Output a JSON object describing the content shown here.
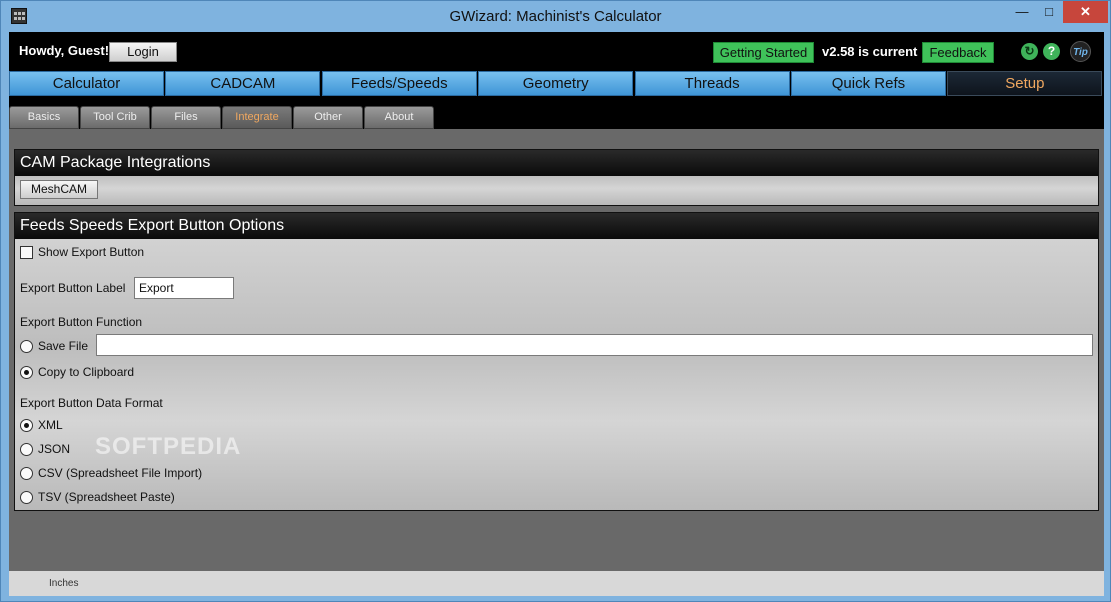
{
  "window": {
    "title": "GWizard: Machinist's Calculator"
  },
  "topbar": {
    "greeting": "Howdy, Guest!",
    "login_label": "Login",
    "getting_started_label": "Getting Started",
    "version_text": "v2.58 is current",
    "feedback_label": "Feedback",
    "icons": [
      "refresh-icon",
      "help-icon",
      "tip-icon"
    ],
    "help_glyph": "?",
    "tip_label": "Tip"
  },
  "main_nav": {
    "tabs": [
      {
        "label": "Calculator"
      },
      {
        "label": "CADCAM"
      },
      {
        "label": "Feeds/Speeds"
      },
      {
        "label": "Geometry"
      },
      {
        "label": "Threads"
      },
      {
        "label": "Quick Refs"
      },
      {
        "label": "Setup"
      }
    ],
    "active": "Setup"
  },
  "sub_nav": {
    "tabs": [
      {
        "label": "Basics"
      },
      {
        "label": "Tool Crib"
      },
      {
        "label": "Files"
      },
      {
        "label": "Integrate"
      },
      {
        "label": "Other"
      },
      {
        "label": "About"
      }
    ],
    "active": "Integrate"
  },
  "cam_panel": {
    "title": "CAM Package Integrations",
    "meshcam_label": "MeshCAM"
  },
  "export_panel": {
    "title": "Feeds Speeds Export Button Options",
    "show_export_label": "Show Export Button",
    "show_export_checked": false,
    "button_label_caption": "Export Button Label",
    "button_label_value": "Export",
    "function_caption": "Export Button Function",
    "save_file_label": "Save File",
    "save_file_path": "",
    "copy_clipboard_label": "Copy to Clipboard",
    "function_selected": "Copy to Clipboard",
    "format_caption": "Export Button Data Format",
    "formats": [
      {
        "label": "XML",
        "selected": true
      },
      {
        "label": "JSON",
        "selected": false
      },
      {
        "label": "CSV (Spreadsheet File Import)",
        "selected": false
      },
      {
        "label": "TSV (Spreadsheet Paste)",
        "selected": false
      }
    ]
  },
  "statusbar": {
    "units": "Inches"
  },
  "watermark": "SOFTPEDIA",
  "colors": {
    "nav_tab": "#3f95d6",
    "active_tab_text": "#f0a860",
    "green_button": "#3fc25a",
    "close_button": "#c7463c"
  }
}
